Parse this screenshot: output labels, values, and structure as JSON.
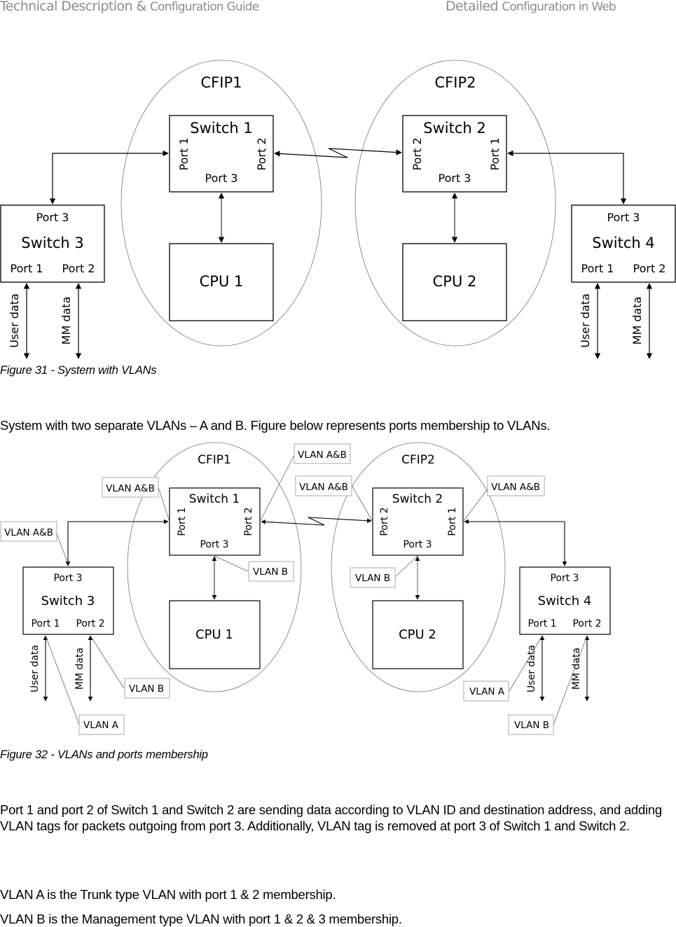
{
  "header": {
    "left_main": "Technical Description & ",
    "left_cond": "Configuration Guide",
    "right_main": "Detailed ",
    "right_cond": "Configuration in Web",
    "text_color": "#8c8c8c"
  },
  "figure31": {
    "caption": "Figure 31 - System with VLANs",
    "domains": [
      "CFIP1",
      "CFIP2"
    ],
    "switch1": {
      "title": "Switch 1",
      "port_left": "Port 1",
      "port_right": "Port 2",
      "port_bottom": "Port 3"
    },
    "switch2": {
      "title": "Switch 2",
      "port_left": "Port 2",
      "port_right": "Port 1",
      "port_bottom": "Port 3"
    },
    "switch3": {
      "title": "Switch 3",
      "port_top": "Port 3",
      "port_a": "Port 1",
      "port_b": "Port 2"
    },
    "switch4": {
      "title": "Switch 4",
      "port_top": "Port 3",
      "port_a": "Port 1",
      "port_b": "Port 2"
    },
    "cpu1": "CPU 1",
    "cpu2": "CPU 2",
    "user_data": "User data",
    "mm_data": "MM data"
  },
  "intro_text": "System with two separate VLANs – A and B. Figure below represents ports membership to VLANs.",
  "figure32": {
    "caption": "Figure 32 - VLANs and ports membership",
    "domains": [
      "CFIP1",
      "CFIP2"
    ],
    "switch1": {
      "title": "Switch 1",
      "port_left": "Port 1",
      "port_right": "Port 2",
      "port_bottom": "Port 3"
    },
    "switch2": {
      "title": "Switch 2",
      "port_left": "Port 2",
      "port_right": "Port 1",
      "port_bottom": "Port 3"
    },
    "switch3": {
      "title": "Switch 3",
      "port_top": "Port 3",
      "port_a": "Port 1",
      "port_b": "Port 2"
    },
    "switch4": {
      "title": "Switch 4",
      "port_top": "Port 3",
      "port_a": "Port 1",
      "port_b": "Port 2"
    },
    "cpu1": "CPU 1",
    "cpu2": "CPU 2",
    "user_data": "User data",
    "mm_data": "MM data",
    "vlan_labels": {
      "sw3_port3": "VLAN A&B",
      "sw1_port1": "VLAN A&B",
      "sw1_port2": "VLAN A&B",
      "sw2_port2": "VLAN A&B",
      "sw2_port1": "VLAN A&B",
      "sw1_port3": "VLAN B",
      "sw2_port3": "VLAN B",
      "sw3_port2": "VLAN B",
      "sw3_port1": "VLAN A",
      "sw4_port1": "VLAN A",
      "sw4_port2": "VLAN B"
    }
  },
  "paragraphs": [
    "Port 1 and port 2 of Switch 1 and Switch 2 are sending data according to VLAN ID and destination address, and adding VLAN tags for packets outgoing from port 3. Additionally, VLAN tag is removed at port 3 of Switch 1 and Switch 2.",
    "VLAN A is the Trunk type VLAN with port 1 & 2 membership.",
    "VLAN B is the Management type VLAN with port 1 & 2 & 3 membership."
  ]
}
